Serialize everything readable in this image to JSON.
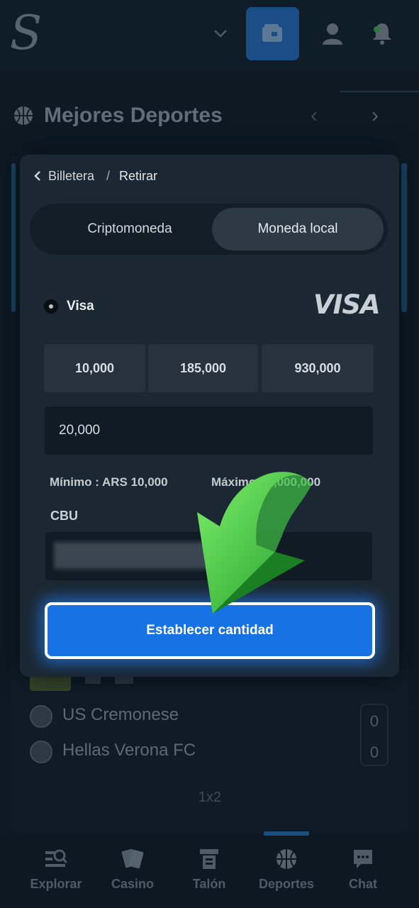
{
  "header": {
    "logo_letter": "S",
    "colors": {
      "wallet_button": "#1b4e86",
      "accent": "#1773e3"
    }
  },
  "section": {
    "title": "Mejores Deportes",
    "prev_icon": "‹",
    "next_icon": "›"
  },
  "match": {
    "teams": [
      {
        "name": "US Cremonese",
        "score": "0"
      },
      {
        "name": "Hellas Verona FC",
        "score": "0"
      }
    ],
    "odds_label": "1x2"
  },
  "nav": {
    "items": [
      {
        "label": "Explorar",
        "icon": "explore-icon"
      },
      {
        "label": "Casino",
        "icon": "casino-icon"
      },
      {
        "label": "Talón",
        "icon": "ticket-icon"
      },
      {
        "label": "Deportes",
        "icon": "sports-ball-icon"
      },
      {
        "label": "Chat",
        "icon": "chat-icon"
      }
    ],
    "active": "Deportes"
  },
  "modal": {
    "breadcrumb": {
      "wallet": "Billetera",
      "separator": "/",
      "current": "Retirar"
    },
    "tabs": [
      {
        "label": "Criptomoneda",
        "selected": false
      },
      {
        "label": "Moneda local",
        "selected": true
      }
    ],
    "method": {
      "label": "Visa",
      "brand": "VISA",
      "selected": true
    },
    "preset_amounts": [
      "10,000",
      "185,000",
      "930,000"
    ],
    "amount_value": "20,000",
    "limits": {
      "min": "Mínimo : ARS 10,000",
      "max": "Máximo : 2,000,000"
    },
    "cbu_label": "CBU",
    "submit_label": "Establecer cantidad"
  }
}
